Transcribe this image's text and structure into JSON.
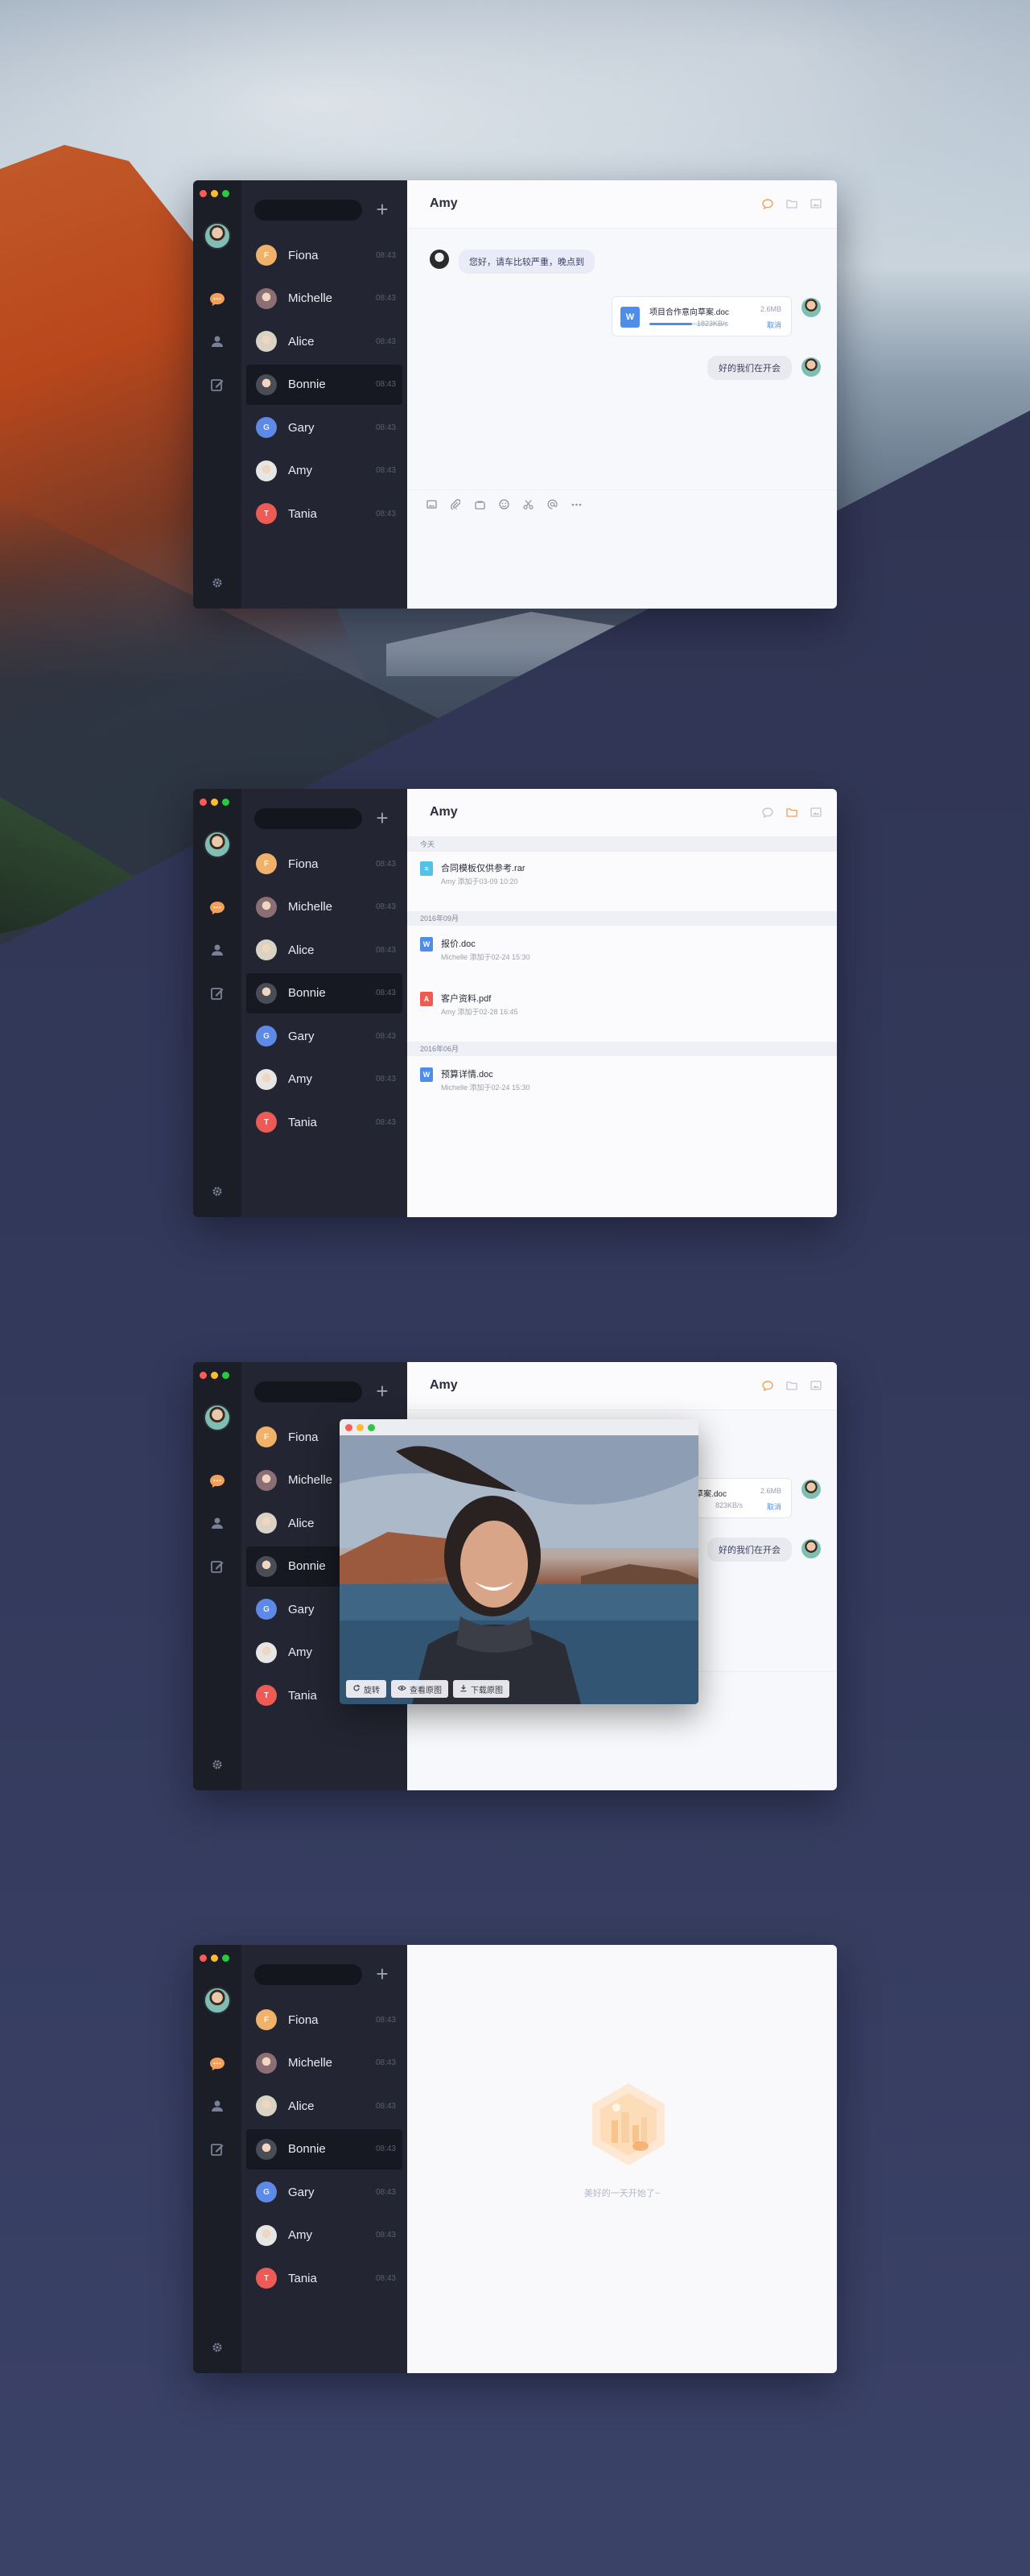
{
  "contacts": [
    {
      "name": "Fiona",
      "time": "08:43",
      "initial": "F",
      "color": "#f0b26a"
    },
    {
      "name": "Michelle",
      "time": "08:43",
      "initial": "",
      "color": "#8c6f74"
    },
    {
      "name": "Alice",
      "time": "08:43",
      "initial": "",
      "color": "#d8d3c4"
    },
    {
      "name": "Bonnie",
      "time": "08:43",
      "initial": "",
      "color": "#4a4d57"
    },
    {
      "name": "Gary",
      "time": "08:43",
      "initial": "G",
      "color": "#5c8ae6"
    },
    {
      "name": "Amy",
      "time": "08:43",
      "initial": "",
      "color": "#e8e6e4"
    },
    {
      "name": "Tania",
      "time": "08:43",
      "initial": "T",
      "color": "#ec5b55"
    }
  ],
  "active_contact": "Bonnie",
  "conversation": {
    "title": "Amy",
    "incoming_message": "您好，请车比较严重，晚点到",
    "file": {
      "name": "项目合作意向草案.doc",
      "size": "2.6MB",
      "speed": "1823KB/s",
      "progress": 0.55,
      "cancel_label": "取消"
    },
    "outgoing_message": "好的我们在开会"
  },
  "files_view": {
    "title": "Amy",
    "sections": [
      {
        "label": "今天",
        "files": [
          {
            "name": "合同模板仅供参考.rar",
            "meta": "Amy 添加于03-09 10:20",
            "type": "rar"
          }
        ]
      },
      {
        "label": "2016年09月",
        "files": [
          {
            "name": "报价.doc",
            "meta": "Michelle 添加于02-24 15:30",
            "type": "doc"
          },
          {
            "name": "客户资料.pdf",
            "meta": "Amy 添加于02-28 16:45",
            "type": "pdf"
          }
        ]
      },
      {
        "label": "2016年06月",
        "files": [
          {
            "name": "预算详情.doc",
            "meta": "Michelle 添加于02-24 15:30",
            "type": "doc"
          }
        ]
      }
    ]
  },
  "viewer": {
    "rotate_label": "旋转",
    "original_label": "查看原图",
    "download_label": "下载原图",
    "partial_file_name": "向草案.doc",
    "partial_size": "2.6MB",
    "partial_speed": "823KB/s",
    "partial_cancel": "取消",
    "partial_reply": "好的我们在开会"
  },
  "empty_view": {
    "text": "美好的一天开始了~"
  },
  "colors": {
    "accent": "#f5a05a",
    "blue": "#4f8ee8",
    "sidebar_dark": "#1b1d27",
    "list_dark": "#232632"
  },
  "icons": {
    "rail": [
      "chat-icon",
      "user-icon",
      "edit-icon",
      "settings-icon"
    ],
    "head": [
      "message-icon",
      "folder-icon",
      "image-icon"
    ],
    "composer": [
      "image-icon",
      "attachment-icon",
      "bag-icon",
      "emoji-icon",
      "scissors-icon",
      "at-icon",
      "more-icon"
    ]
  }
}
